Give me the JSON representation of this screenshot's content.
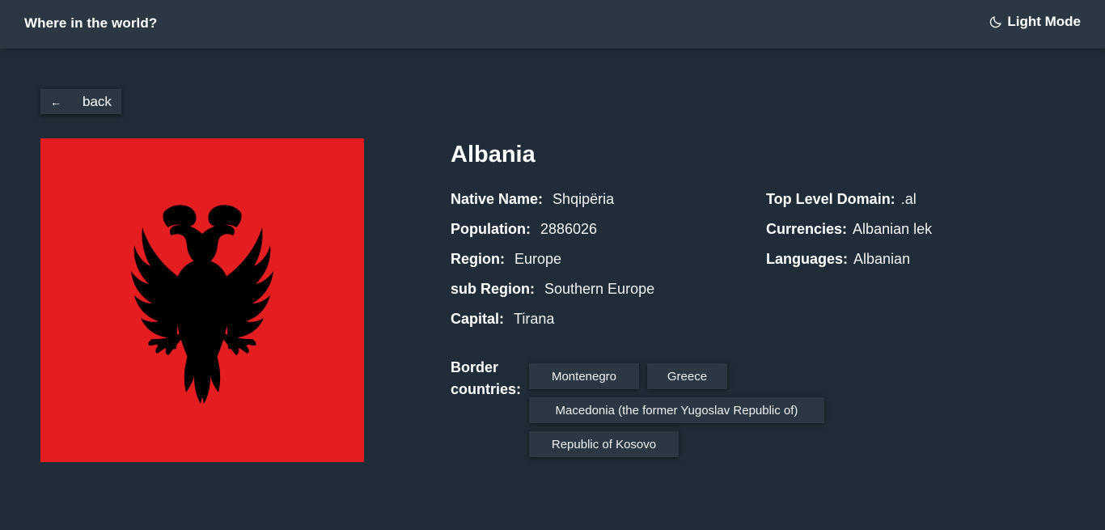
{
  "header": {
    "title": "Where in the world?",
    "mode_label": "Light Mode",
    "mode_icon": "moon-icon"
  },
  "back": {
    "arrow": "←",
    "label": "back"
  },
  "country": {
    "name": "Albania",
    "flag_icon": "albania-flag",
    "details_left": [
      {
        "label": "Native Name:",
        "value": "Shqipëria"
      },
      {
        "label": "Population:",
        "value": "2886026"
      },
      {
        "label": "Region:",
        "value": "Europe"
      },
      {
        "label": "sub Region:",
        "value": "Southern Europe"
      },
      {
        "label": "Capital:",
        "value": "Tirana"
      }
    ],
    "details_right": [
      {
        "label": "Top Level Domain:",
        "value": ".al"
      },
      {
        "label": "Currencies:",
        "value": "Albanian lek"
      },
      {
        "label": "Languages:",
        "value": "Albanian"
      }
    ],
    "border_label_line1": "Border",
    "border_label_line2": "countries:",
    "borders": [
      "Montenegro",
      "Greece",
      "Macedonia (the former Yugoslav Republic of)",
      "Republic of Kosovo"
    ]
  },
  "colors": {
    "background": "#202c37",
    "surface": "#2b3844",
    "flag_red": "#e41e20",
    "flag_black": "#000000"
  }
}
